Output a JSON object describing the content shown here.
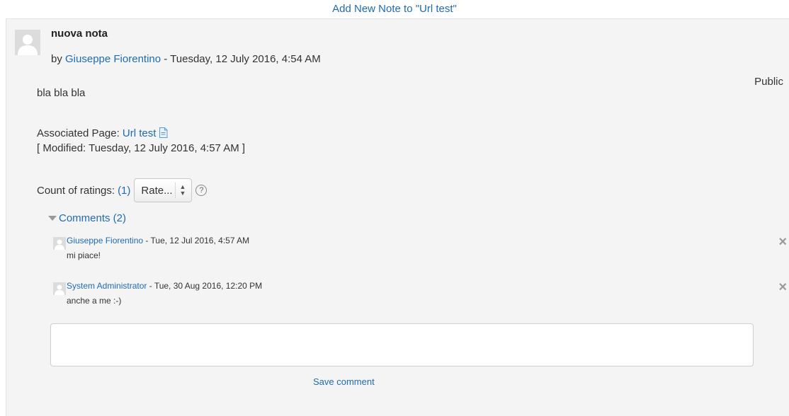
{
  "header": {
    "add_note_link": "Add New Note to \"Url test\""
  },
  "note": {
    "title": "nuova nota",
    "by_prefix": "by",
    "author": "Giuseppe Fiorentino",
    "date_sep": " - ",
    "date": "Tuesday, 12 July 2016, 4:54 AM",
    "visibility": "Public",
    "body": "bla bla bla",
    "associated_label": "Associated Page: ",
    "associated_page": "Url test",
    "modified": "[ Modified: Tuesday, 12 July 2016, 4:57 AM ]",
    "icons": {
      "page": "document-icon"
    }
  },
  "ratings": {
    "label": "Count of ratings:",
    "count": "(1)",
    "select_value": "Rate...",
    "help_glyph": "?"
  },
  "comments": {
    "toggle_label": "Comments (2)",
    "items": [
      {
        "author": "Giuseppe Fiorentino",
        "date": " - Tue, 12 Jul 2016, 4:57 AM",
        "text": "mi piace!",
        "delete_glyph": "×"
      },
      {
        "author": "System Administrator",
        "date": " - Tue, 30 Aug 2016, 12:20 PM",
        "text": "anche a me :-)",
        "delete_glyph": "×"
      }
    ],
    "input_value": "",
    "save_label": "Save comment"
  },
  "colors": {
    "link": "#1f6bb0",
    "panel_bg": "#f4f4f4",
    "text": "#333333"
  }
}
